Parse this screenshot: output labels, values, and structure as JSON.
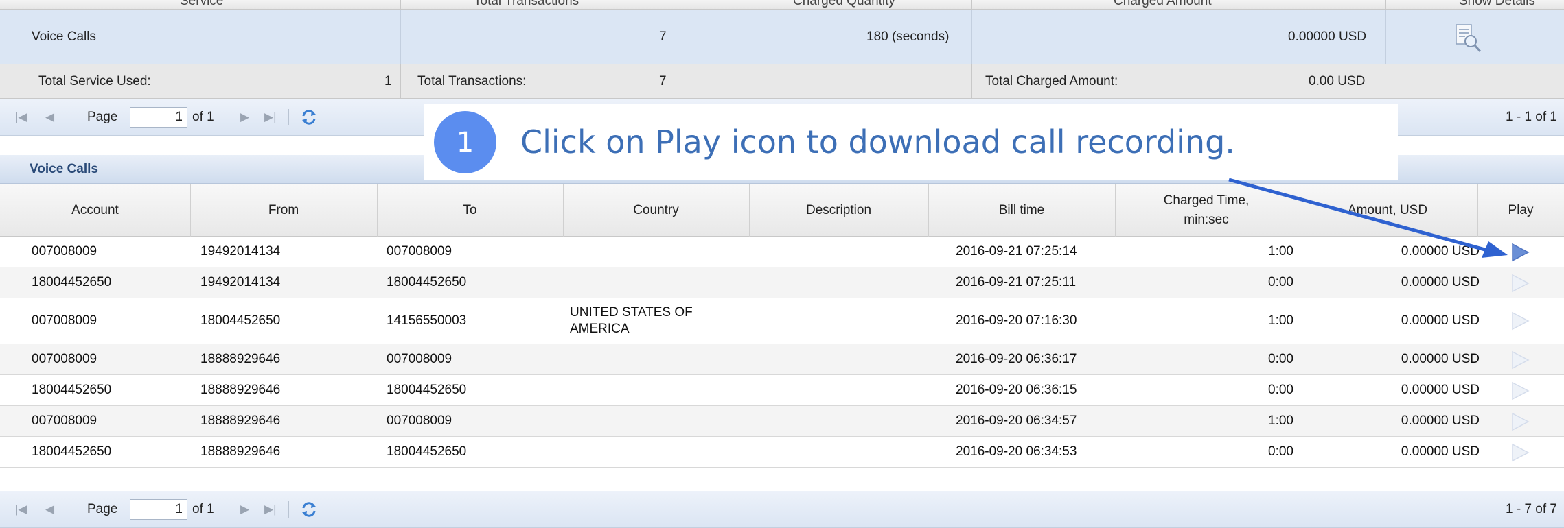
{
  "summary": {
    "header_columns": [
      "Service",
      "Total Transactions",
      "Charged Quantity",
      "Charged Amount",
      "Show Details"
    ],
    "service": {
      "name": "Voice Calls",
      "total_transactions": "7",
      "charged_quantity": "180 (seconds)",
      "charged_amount": "0.00000 USD",
      "details_icon": "view-details-icon"
    },
    "totals": {
      "service_used_label": "Total Service Used:",
      "service_used_value": "1",
      "transactions_label": "Total Transactions:",
      "transactions_value": "7",
      "charged_amount_label": "Total Charged Amount:",
      "charged_amount_value": "0.00 USD"
    }
  },
  "pager_top": {
    "page_label": "Page",
    "page_value": "1",
    "of_label": "of 1",
    "info": "1 - 1 of 1"
  },
  "callout": {
    "number": "1",
    "text": "Click on Play icon to download call recording."
  },
  "voice_calls": {
    "title": "Voice Calls",
    "columns": [
      "Account",
      "From",
      "To",
      "Country",
      "Description",
      "Bill time",
      "Charged Time,\nmin:sec",
      "Amount, USD",
      "Play"
    ],
    "rows": [
      {
        "account": "007008009",
        "from": "19492014134",
        "to": "007008009",
        "country": "",
        "description": "",
        "bill_time": "2016-09-21 07:25:14",
        "charged_time": "1:00",
        "amount": "0.00000 USD"
      },
      {
        "account": "18004452650",
        "from": "19492014134",
        "to": "18004452650",
        "country": "",
        "description": "",
        "bill_time": "2016-09-21 07:25:11",
        "charged_time": "0:00",
        "amount": "0.00000 USD"
      },
      {
        "account": "007008009",
        "from": "18004452650",
        "to": "14156550003",
        "country": "UNITED STATES OF AMERICA",
        "description": "",
        "bill_time": "2016-09-20 07:16:30",
        "charged_time": "1:00",
        "amount": "0.00000 USD"
      },
      {
        "account": "007008009",
        "from": "18888929646",
        "to": "007008009",
        "country": "",
        "description": "",
        "bill_time": "2016-09-20 06:36:17",
        "charged_time": "0:00",
        "amount": "0.00000 USD"
      },
      {
        "account": "18004452650",
        "from": "18888929646",
        "to": "18004452650",
        "country": "",
        "description": "",
        "bill_time": "2016-09-20 06:36:15",
        "charged_time": "0:00",
        "amount": "0.00000 USD"
      },
      {
        "account": "007008009",
        "from": "18888929646",
        "to": "007008009",
        "country": "",
        "description": "",
        "bill_time": "2016-09-20 06:34:57",
        "charged_time": "1:00",
        "amount": "0.00000 USD"
      },
      {
        "account": "18004452650",
        "from": "18888929646",
        "to": "18004452650",
        "country": "",
        "description": "",
        "bill_time": "2016-09-20 06:34:53",
        "charged_time": "0:00",
        "amount": "0.00000 USD"
      }
    ]
  },
  "pager_bottom": {
    "page_label": "Page",
    "page_value": "1",
    "of_label": "of 1",
    "info": "1 - 7 of 7"
  },
  "colors": {
    "callout_circle": "#5b8def",
    "callout_text": "#3d6fb6",
    "arrow": "#2f62d0",
    "play_active": "#6a8fd6",
    "play_inactive": "#d9e1ee"
  }
}
